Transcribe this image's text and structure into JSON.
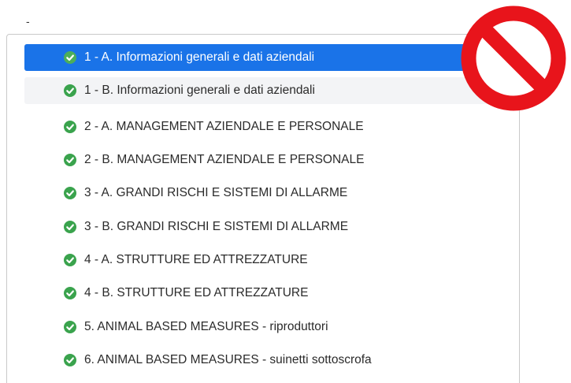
{
  "top_mark": "-",
  "checklist": {
    "items": [
      {
        "label": "1 - A. Informazioni generali e dati aziendali",
        "state": "active",
        "icon": "check-circle-icon"
      },
      {
        "label": "1 - B. Informazioni generali e dati aziendali",
        "state": "hover",
        "icon": "check-circle-icon"
      },
      {
        "label": "2 - A. MANAGEMENT AZIENDALE E PERSONALE",
        "state": "normal",
        "icon": "check-circle-icon"
      },
      {
        "label": "2 - B. MANAGEMENT AZIENDALE E PERSONALE",
        "state": "normal",
        "icon": "check-circle-icon"
      },
      {
        "label": "3 - A. GRANDI RISCHI E SISTEMI DI ALLARME",
        "state": "normal",
        "icon": "check-circle-icon"
      },
      {
        "label": "3 - B. GRANDI RISCHI E SISTEMI DI ALLARME",
        "state": "normal",
        "icon": "check-circle-icon"
      },
      {
        "label": "4 - A. STRUTTURE ED ATTREZZATURE",
        "state": "normal",
        "icon": "check-circle-icon"
      },
      {
        "label": "4 - B. STRUTTURE ED ATTREZZATURE",
        "state": "normal",
        "icon": "check-circle-icon"
      },
      {
        "label": "5. ANIMAL BASED MEASURES - riproduttori",
        "state": "normal",
        "icon": "check-circle-icon"
      },
      {
        "label": "6. ANIMAL BASED MEASURES - suinetti sottoscrofa",
        "state": "normal",
        "icon": "check-circle-icon"
      }
    ]
  },
  "colors": {
    "active_bg": "#1a73e8",
    "check_green": "#3aa34d",
    "prohibition_red": "#e8141b"
  },
  "overlay_icon": "prohibition-icon"
}
